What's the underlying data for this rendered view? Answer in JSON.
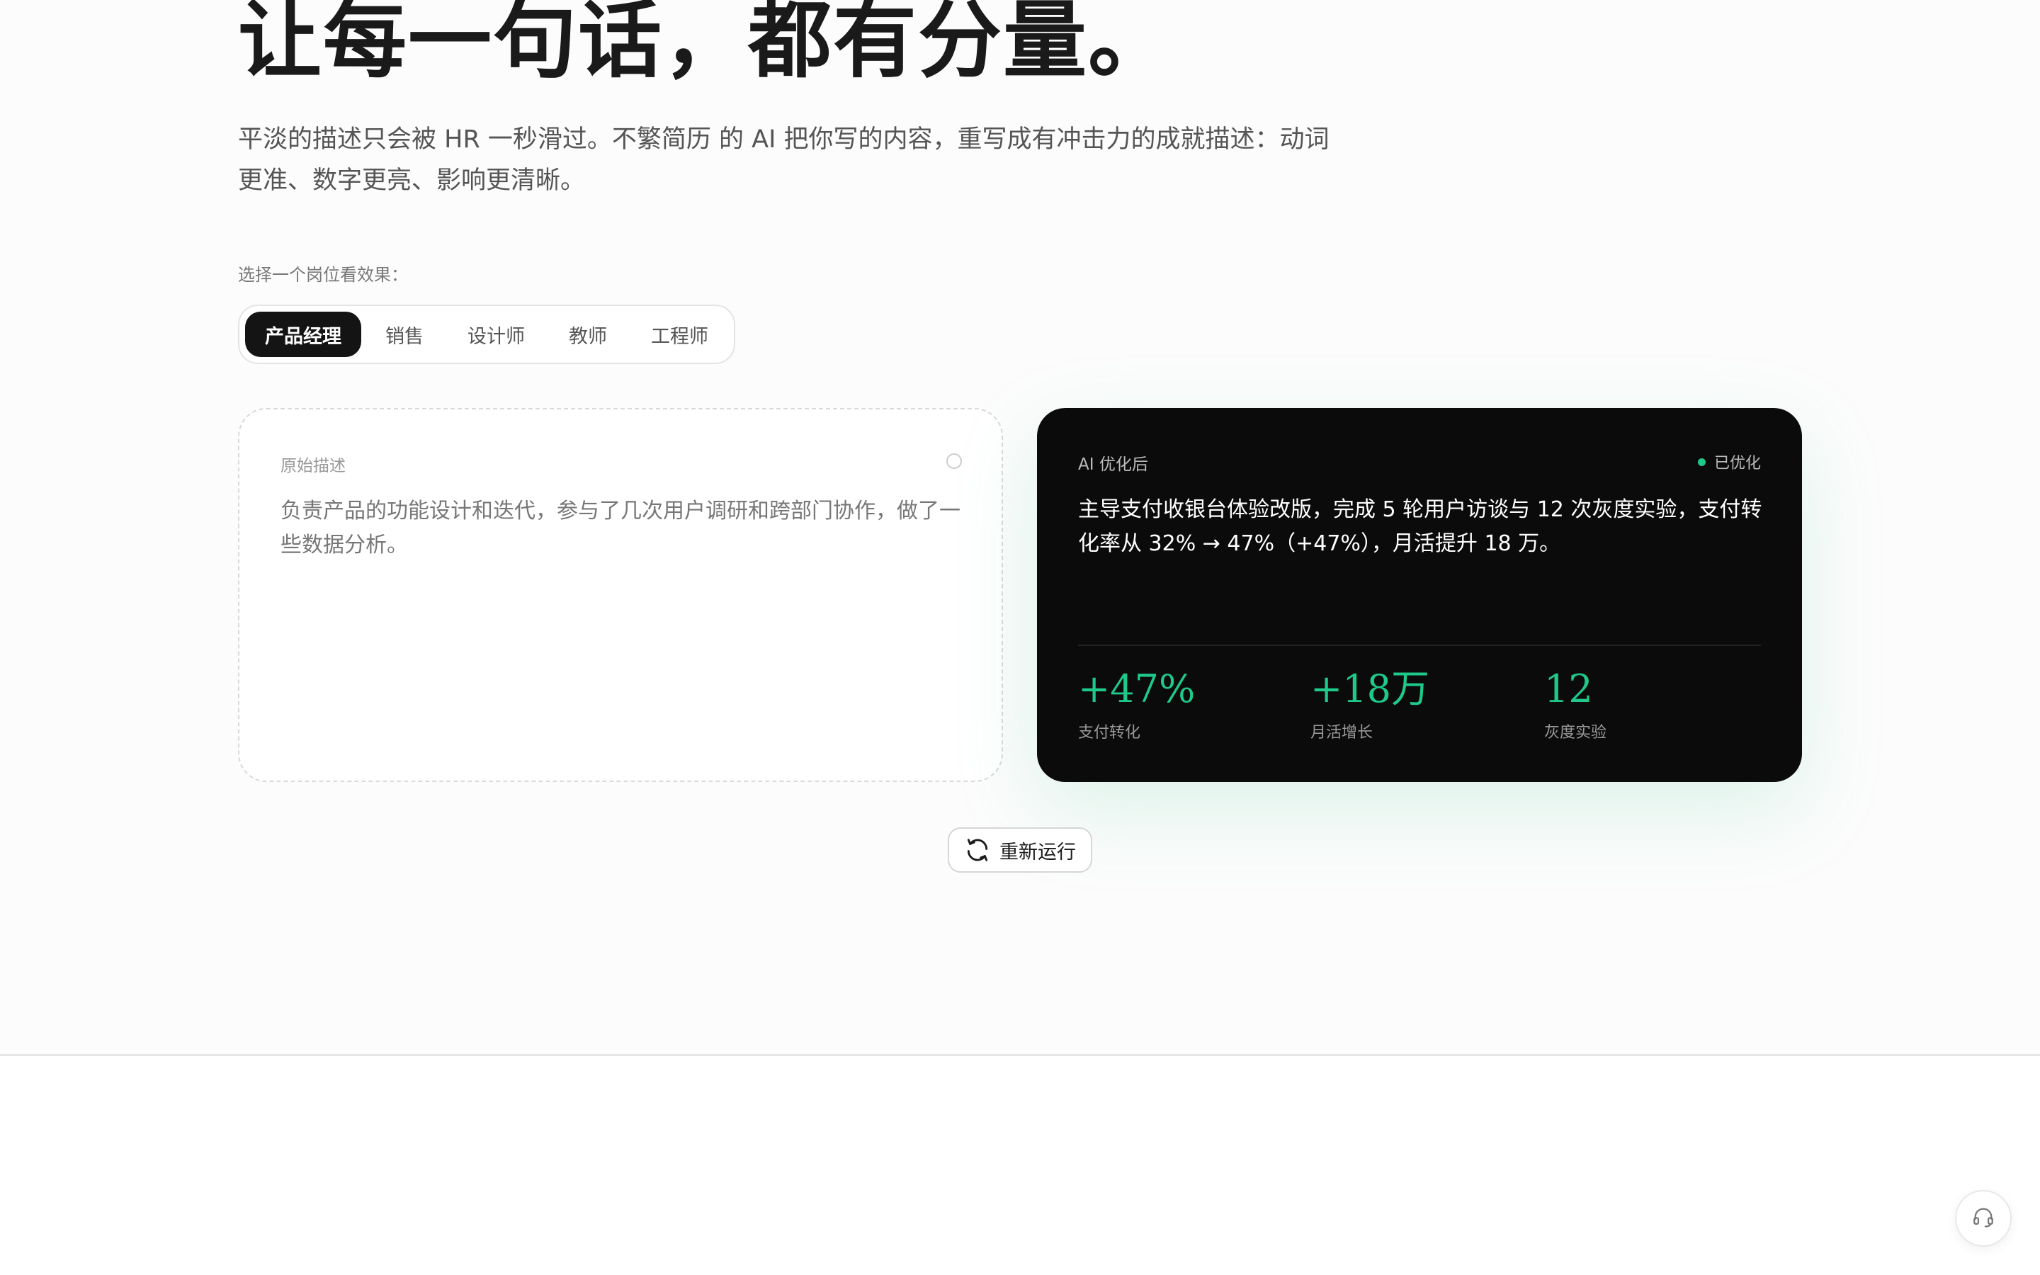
{
  "hero": {
    "title": "让每一句话，都有分量。",
    "description": "平淡的描述只会被 HR 一秒滑过。不繁简历 的 AI 把你写的内容，重写成有冲击力的成就描述：动词更准、数字更亮、影响更清晰。"
  },
  "picker": {
    "label": "选择一个岗位看效果：",
    "tabs": [
      {
        "label": "产品经理",
        "active": true
      },
      {
        "label": "销售",
        "active": false
      },
      {
        "label": "设计师",
        "active": false
      },
      {
        "label": "教师",
        "active": false
      },
      {
        "label": "工程师",
        "active": false
      }
    ]
  },
  "original": {
    "label": "原始描述",
    "text": "负责产品的功能设计和迭代，参与了几次用户调研和跨部门协作，做了一些数据分析。"
  },
  "optimized": {
    "label": "AI 优化后",
    "status": "已优化",
    "text": "主导支付收银台体验改版，完成 5 轮用户访谈与 12 次灰度实验，支付转化率从 32% → 47%（+47%），月活提升 18 万。",
    "metrics": [
      {
        "value": "+47%",
        "caption": "支付转化"
      },
      {
        "value": "+18万",
        "caption": "月活增长"
      },
      {
        "value": "12",
        "caption": "灰度实验"
      }
    ]
  },
  "actions": {
    "rerun_label": "重新运行"
  },
  "icons": {
    "rerun": "refresh-icon",
    "support": "headset-icon"
  },
  "colors": {
    "accent": "#1ec98a",
    "dark_card": "#0b0b0c",
    "active_tab": "#141414"
  }
}
